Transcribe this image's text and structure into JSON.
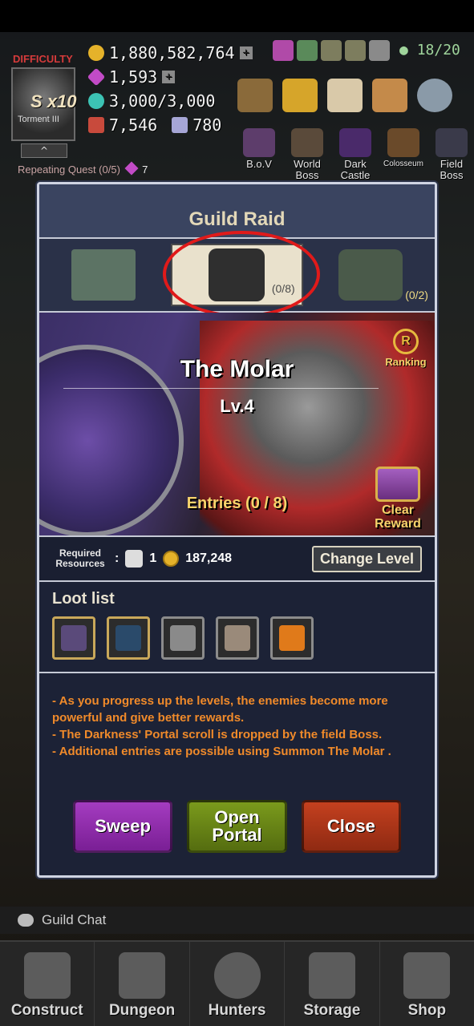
{
  "hud": {
    "difficulty_label": "DIFFICULTY",
    "difficulty_value": "S x10",
    "difficulty_name": "Torment III",
    "gold": "1,880,582,764",
    "gems": "1,593",
    "stamina": "3,000/3,000",
    "chests": "7,546",
    "crystals": "780",
    "members": "18/20",
    "expand_icon": "^",
    "repeating_quest": "Repeating Quest (0/5)",
    "repeating_quest_count": "7",
    "boss_menu": [
      {
        "label": "B.o.V"
      },
      {
        "label": "World Boss"
      },
      {
        "label": "Dark Castle"
      },
      {
        "label": "Colosseum"
      },
      {
        "label": "Field Boss"
      }
    ]
  },
  "dialog": {
    "title": "Guild Raid",
    "tabs": [
      {
        "name": "castle",
        "count": ""
      },
      {
        "name": "the-molar",
        "count": "(0/8)"
      },
      {
        "name": "horned-boss",
        "count": "(0/2)"
      }
    ],
    "boss_name": "The Molar",
    "boss_level": "Lv.4",
    "ranking": "Ranking",
    "ranking_badge": "R",
    "entries": "Entries (0 / 8)",
    "clear_reward": "Clear Reward",
    "required_resources": "Required Resources",
    "required_colon": ":",
    "scroll_count": "1",
    "gold_cost": "187,248",
    "change_level": "Change Level",
    "loot_title": "Loot list",
    "loot_items": [
      "belt-purple",
      "belt-blue",
      "rune-1",
      "rune-2",
      "feather"
    ],
    "description": [
      "- As you progress up the levels, the enemies become more powerful and give better rewards.",
      "- The Darkness' Portal scroll is dropped by the field Boss.",
      "- Additional entries are possible using Summon The Molar ."
    ],
    "buttons": {
      "sweep": "Sweep",
      "open_portal": "Open Portal",
      "close": "Close"
    }
  },
  "chat": {
    "label": "Guild Chat"
  },
  "nav": [
    {
      "label": "Construct"
    },
    {
      "label": "Dungeon"
    },
    {
      "label": "Hunters"
    },
    {
      "label": "Storage"
    },
    {
      "label": "Shop"
    }
  ],
  "colors": {
    "accent_gold": "#f6d36b",
    "highlight_circle": "#e01a1a",
    "desc_orange": "#f08a2a"
  }
}
